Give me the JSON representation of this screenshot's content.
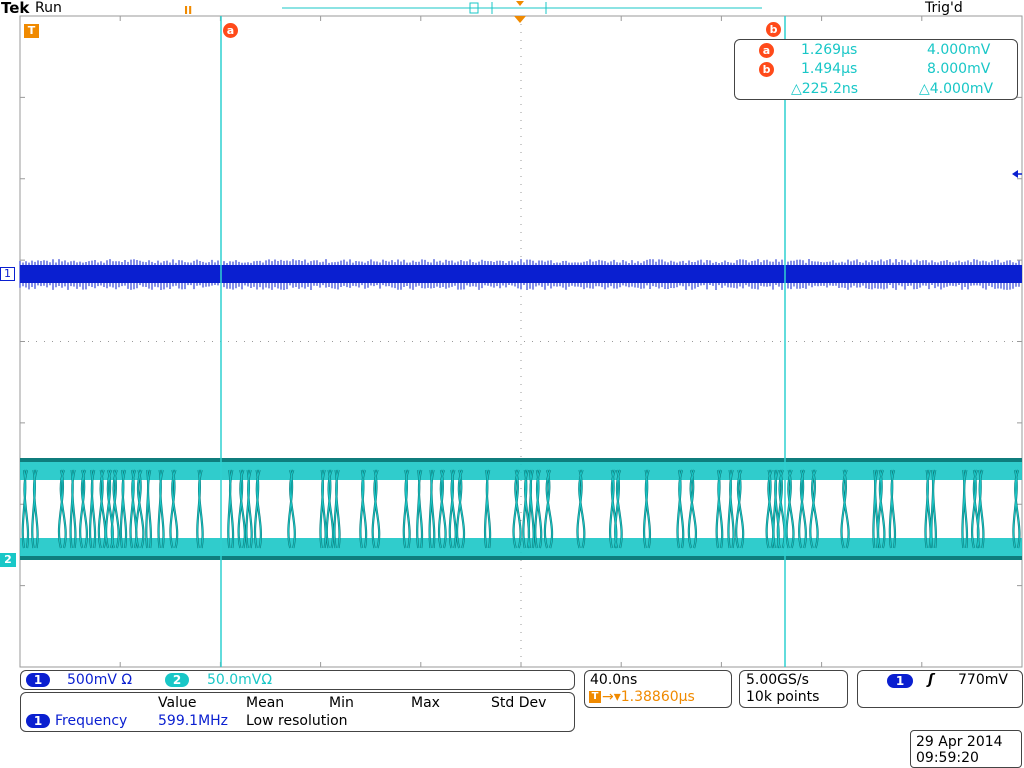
{
  "header": {
    "brand": "Tek",
    "run_state": "Run",
    "trigger_state": "Trig'd"
  },
  "colors": {
    "ch1": "#0a1fd0",
    "ch2": "#19c7c7",
    "ch2_dark": "#0f7d7d",
    "cursor_line": "#2fd0d0",
    "orange": "#f08a00",
    "cursor_marker": "#ff4a1a",
    "grid": "#9a9a9a"
  },
  "markers": {
    "trigger_pos": "T",
    "ch1_marker": "1",
    "ch2_marker": "2",
    "cursor_a": "a",
    "cursor_b": "b",
    "pause_icon": "II"
  },
  "cursor_readout": {
    "a_time": "1.269µs",
    "a_volt": "4.000mV",
    "b_time": "1.494µs",
    "b_volt": "8.000mV",
    "delta_time": "△225.2ns",
    "delta_volt": "△4.000mV"
  },
  "channels": {
    "ch1_num": "1",
    "ch1_scale": "500mV Ω",
    "ch2_num": "2",
    "ch2_scale": "50.0mVΩ"
  },
  "measurement": {
    "headers": [
      "Value",
      "Mean",
      "Min",
      "Max",
      "Std Dev"
    ],
    "channel": "1",
    "name": "Frequency",
    "value": "599.1MHz",
    "note": "Low resolution"
  },
  "horizontal": {
    "scale": "40.0ns",
    "delay": "→▾1.38860µs",
    "delay_icon": "T"
  },
  "acquisition": {
    "sample_rate": "5.00GS/s",
    "record_length": "10k points"
  },
  "trigger": {
    "source": "1",
    "slope_icon": "ʃ",
    "level": "770mV"
  },
  "datetime": {
    "date": "29 Apr  2014",
    "time": "09:59:20"
  }
}
